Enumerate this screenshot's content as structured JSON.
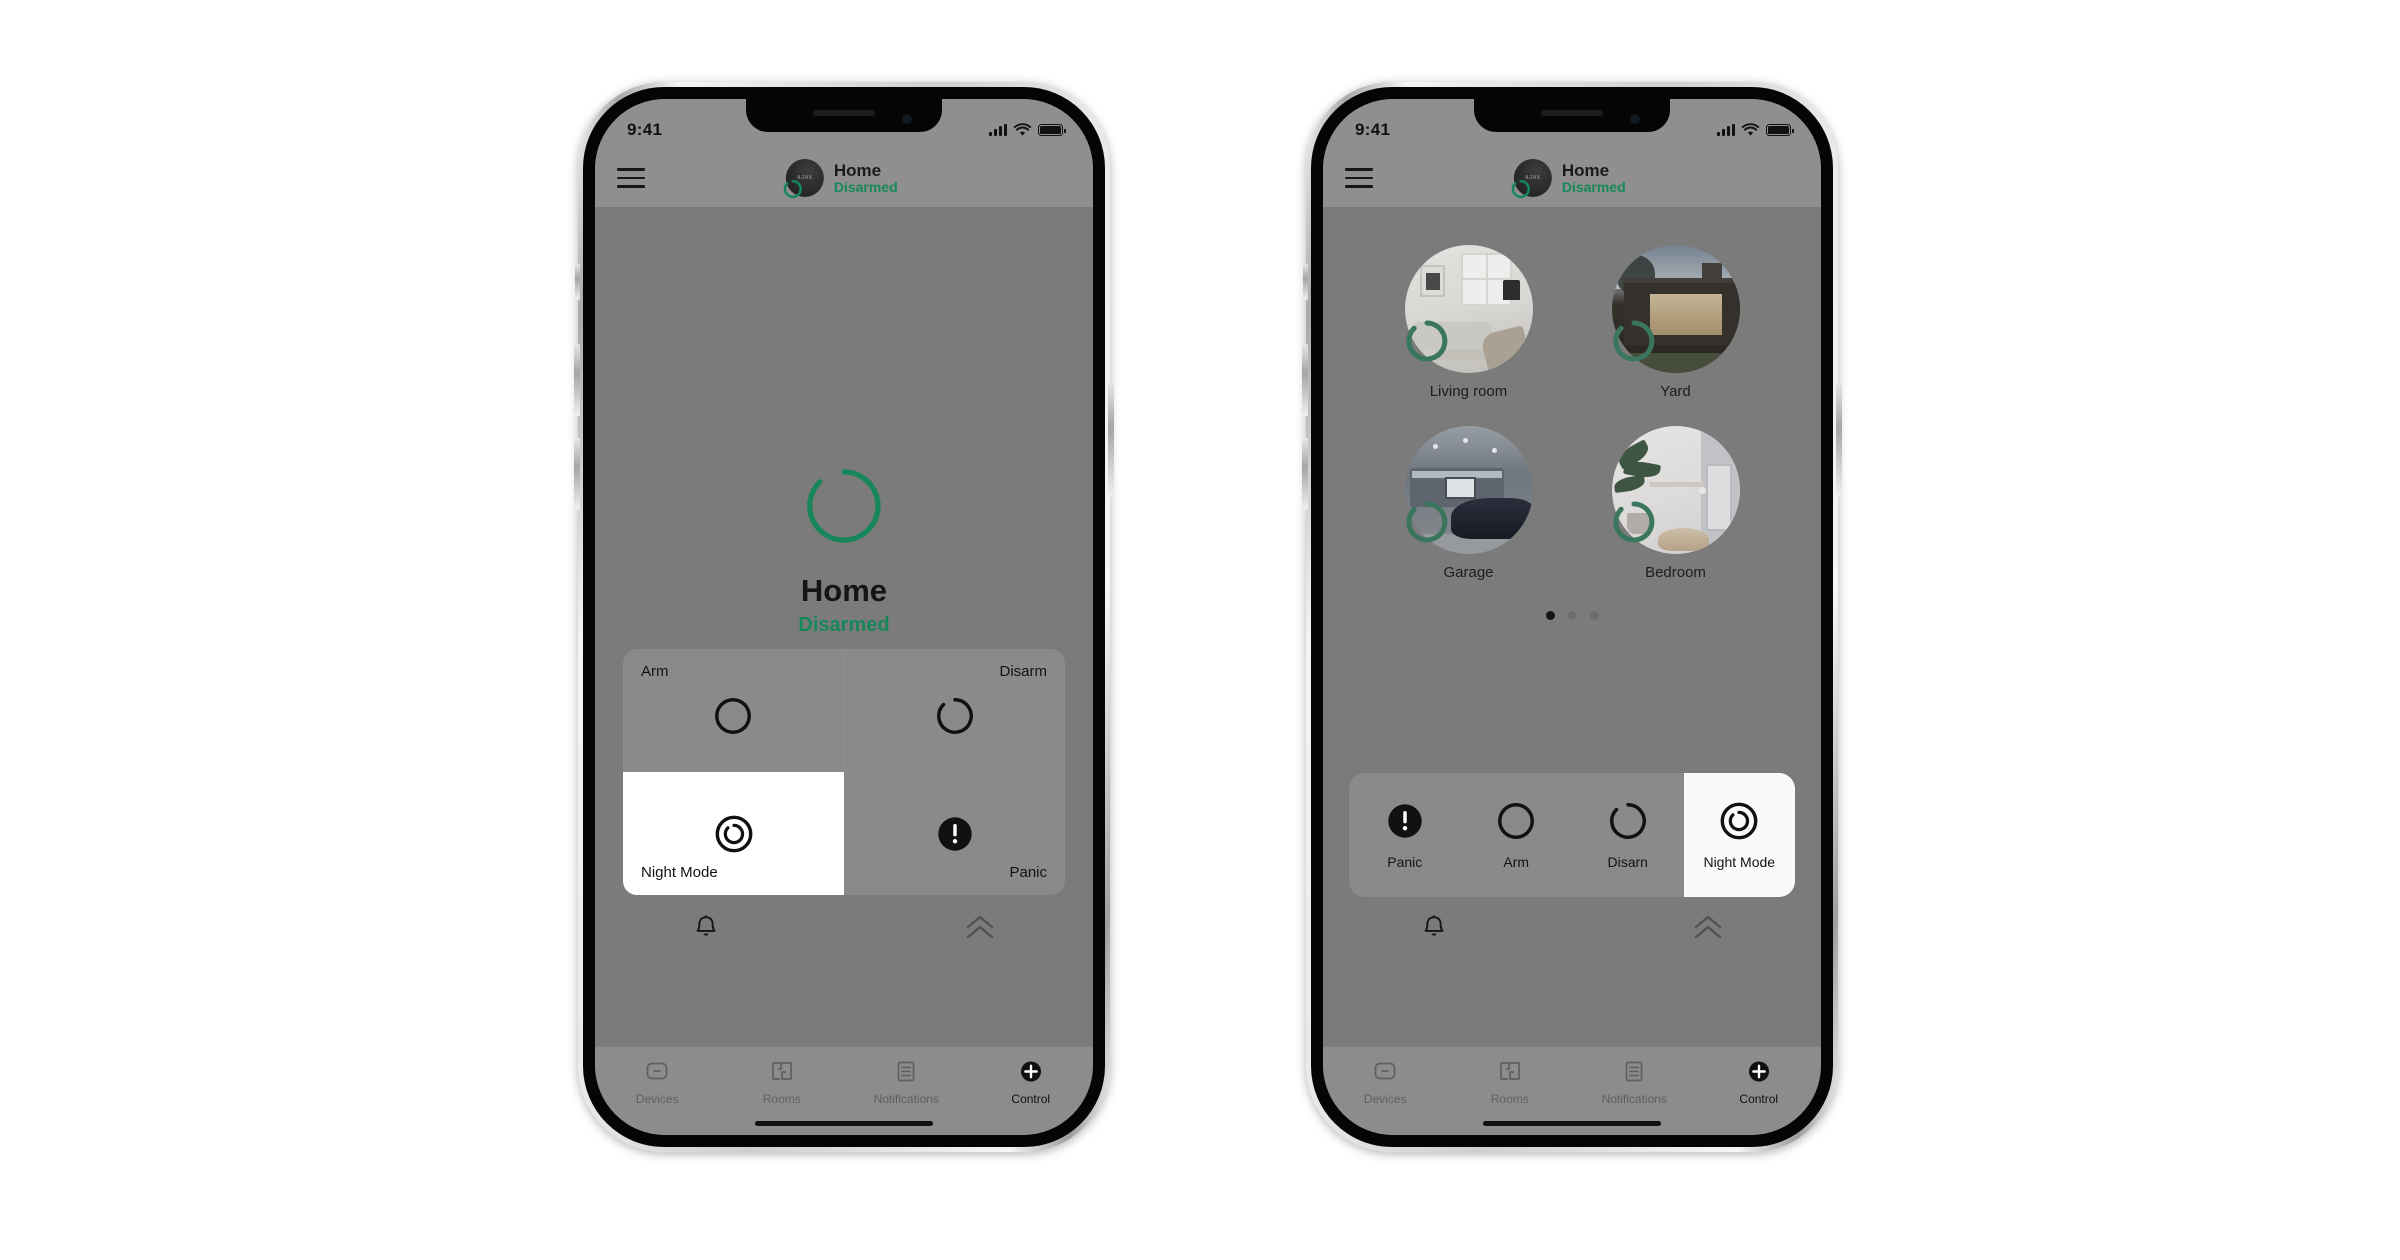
{
  "colors": {
    "accent_green": "#17875b",
    "screen_bg": "#7b7b7b",
    "header_bg": "#8f8f8f",
    "card_bg": "#8a8a8a",
    "selected_bg": "#ffffff",
    "text_dark": "#141414"
  },
  "status_bar": {
    "time": "9:41",
    "cellular_icon": "signal-bars-icon",
    "wifi_icon": "wifi-icon",
    "battery_icon": "battery-full-icon"
  },
  "header": {
    "menu_icon": "hamburger-menu-icon",
    "avatar_mark": "AJAX",
    "badge_icon": "arc-ring-icon",
    "title": "Home",
    "status": "Disarmed"
  },
  "phone_left": {
    "hero": {
      "ring_icon": "arc-ring-icon",
      "title": "Home",
      "status": "Disarmed"
    },
    "control_grid": [
      {
        "label": "Arm",
        "icon": "circle-outline-icon",
        "selected": false,
        "label_pos": "top-left"
      },
      {
        "label": "Disarm",
        "icon": "arc-ring-icon",
        "selected": false,
        "label_pos": "top-right"
      },
      {
        "label": "Night Mode",
        "icon": "double-ring-arc-icon",
        "selected": true,
        "label_pos": "bottom-left"
      },
      {
        "label": "Panic",
        "icon": "exclamation-filled-icon",
        "selected": false,
        "label_pos": "bottom-right"
      }
    ]
  },
  "phone_right": {
    "rooms": [
      {
        "label": "Living room",
        "badge_icon": "arc-ring-icon",
        "art": "art-living"
      },
      {
        "label": "Yard",
        "badge_icon": "arc-ring-icon",
        "art": "art-yard"
      },
      {
        "label": "Garage",
        "badge_icon": "arc-ring-icon",
        "art": "art-garage"
      },
      {
        "label": "Bedroom",
        "badge_icon": "arc-ring-icon",
        "art": "art-bed"
      }
    ],
    "pager": {
      "count": 3,
      "active_index": 0
    },
    "actions": [
      {
        "label": "Panic",
        "icon": "exclamation-filled-icon",
        "selected": false
      },
      {
        "label": "Arm",
        "icon": "circle-outline-icon",
        "selected": false
      },
      {
        "label": "Disarn",
        "icon": "arc-ring-icon",
        "selected": false
      },
      {
        "label": "Night Mode",
        "icon": "double-ring-arc-icon",
        "selected": true
      }
    ]
  },
  "util_bar": {
    "bell_icon": "bell-icon",
    "chevron_icon": "double-chevron-up-icon"
  },
  "tabbar": {
    "items": [
      {
        "label": "Devices",
        "icon": "device-minus-icon",
        "active": false
      },
      {
        "label": "Rooms",
        "icon": "floorplan-icon",
        "active": false
      },
      {
        "label": "Notifications",
        "icon": "document-lines-icon",
        "active": false
      },
      {
        "label": "Control",
        "icon": "plus-circle-filled-icon",
        "active": true
      }
    ]
  }
}
